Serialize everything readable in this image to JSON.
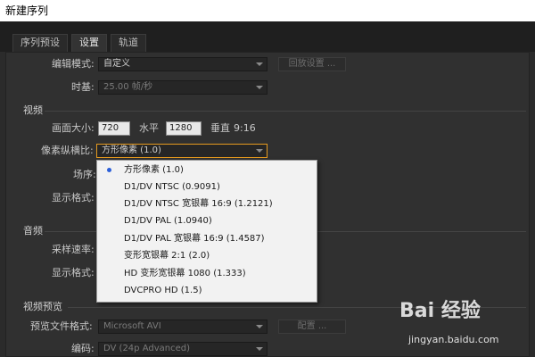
{
  "window": {
    "title": "新建序列"
  },
  "tabs": [
    {
      "label": "序列预设",
      "active": false
    },
    {
      "label": "设置",
      "active": true
    },
    {
      "label": "轨道",
      "active": false
    }
  ],
  "general": {
    "edit_mode_label": "编辑模式:",
    "edit_mode_value": "自定义",
    "playback_settings_label": "回放设置 ...",
    "timebase_label": "时基:",
    "timebase_value": "25.00 帧/秒"
  },
  "video": {
    "section_title": "视频",
    "frame_size_label": "画面大小:",
    "frame_width": "720",
    "horizontal_label": "水平",
    "frame_height": "1280",
    "vertical_label": "垂直",
    "aspect_ratio": "9:16",
    "pixel_aspect_label": "像素纵横比:",
    "pixel_aspect_value": "方形像素 (1.0)",
    "fields_label": "场序:",
    "display_format_label": "显示格式:"
  },
  "pixel_aspect_menu": {
    "selected_index": 0,
    "options": [
      "方形像素 (1.0)",
      "D1/DV NTSC (0.9091)",
      "D1/DV NTSC 宽银幕 16:9 (1.2121)",
      "D1/DV PAL (1.0940)",
      "D1/DV PAL 宽银幕 16:9 (1.4587)",
      "变形宽银幕 2:1 (2.0)",
      "HD 变形宽银幕 1080 (1.333)",
      "DVCPRO HD (1.5)"
    ]
  },
  "audio": {
    "section_title": "音频",
    "sample_rate_label": "采样速率:",
    "display_format_label": "显示格式:"
  },
  "video_preview": {
    "section_title": "视频预览",
    "preview_format_label": "预览文件格式:",
    "preview_format_value": "Microsoft AVI",
    "configure_label": "配置 ...",
    "codec_label": "编码:",
    "codec_value": "DV (24p Advanced)"
  },
  "watermark": {
    "logo_text": "Bai 经验",
    "url": "jingyan.baidu.com"
  },
  "colors": {
    "dialog_bg": "#303030",
    "titlebar_bg": "#ffffff",
    "highlight_border": "#e59a1f",
    "menu_bg": "#f2f2f2",
    "selection_dot": "#2b5fd9"
  },
  "icons": {
    "dropdown_arrow": "chevron-down-icon",
    "selected_marker": "radio-dot-icon"
  }
}
